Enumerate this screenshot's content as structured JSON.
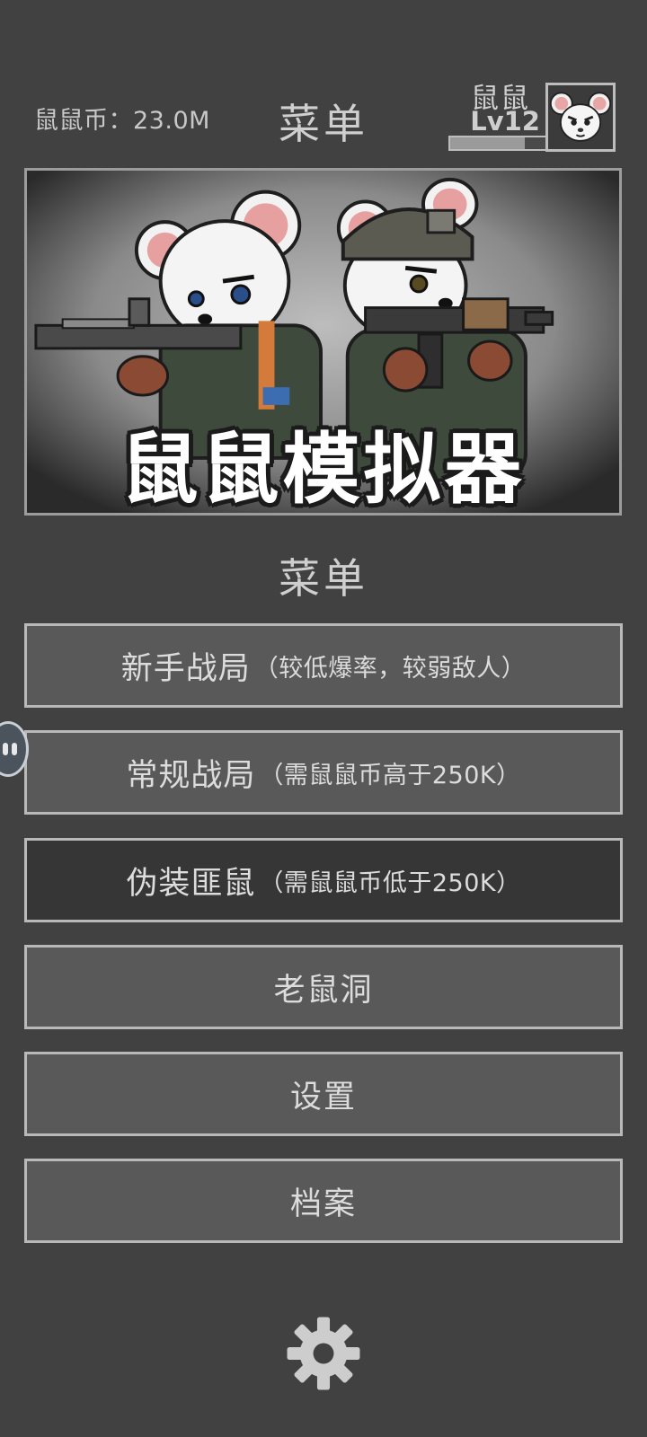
{
  "header": {
    "currency_label": "鼠鼠币：23.0M",
    "title": "菜单",
    "player_name": "鼠鼠",
    "player_level": "Lv12",
    "xp_progress": 0.78
  },
  "banner": {
    "title": "鼠鼠模拟器"
  },
  "menu": {
    "title": "菜单",
    "buttons": [
      {
        "label": "新手战局",
        "sub": "（较低爆率，较弱敌人）"
      },
      {
        "label": "常规战局",
        "sub": "（需鼠鼠币高于250K）"
      },
      {
        "label": "伪装匪鼠",
        "sub": "（需鼠鼠币低于250K）"
      },
      {
        "label": "老鼠洞"
      },
      {
        "label": "设置"
      },
      {
        "label": "档案"
      }
    ]
  },
  "icons": {
    "settings": "gear-icon",
    "floating_handle": "floating-ball-icon"
  },
  "colors": {
    "background": "#414141",
    "button": "#595959",
    "button_selected": "#363636",
    "border": "#b9b9b9"
  }
}
